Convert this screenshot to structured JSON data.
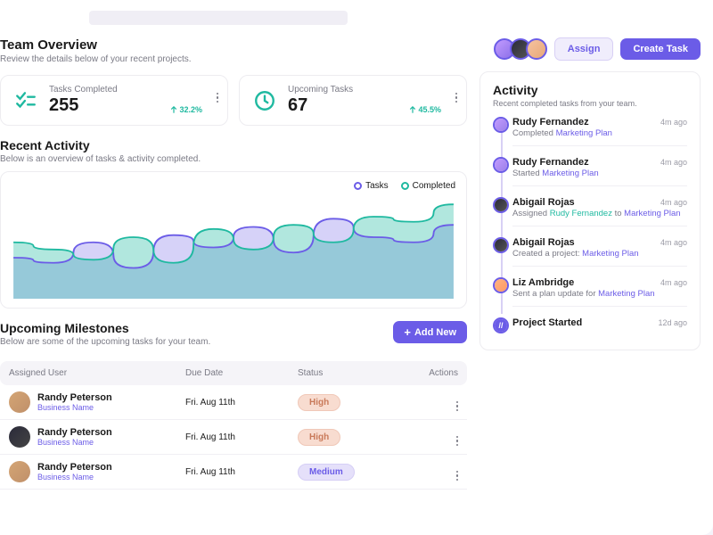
{
  "header": {
    "title": "Team Overview",
    "subtitle": "Review the details below of your recent projects.",
    "assign_label": "Assign",
    "create_task_label": "Create Task"
  },
  "stats": {
    "completed": {
      "label": "Tasks Completed",
      "value": "255",
      "delta": "32.2%"
    },
    "upcoming": {
      "label": "Upcoming Tasks",
      "value": "67",
      "delta": "45.5%"
    }
  },
  "recent_activity": {
    "title": "Recent Activity",
    "subtitle": "Below is an overview of tasks & activity completed.",
    "legend": {
      "tasks": "Tasks",
      "completed": "Completed"
    }
  },
  "chart_data": {
    "type": "area",
    "xlabel": "",
    "ylabel": "",
    "series": [
      {
        "name": "Tasks",
        "color": "#6b5ce7",
        "values": [
          40,
          35,
          55,
          30,
          62,
          50,
          70,
          45,
          78,
          60,
          55,
          72
        ]
      },
      {
        "name": "Completed",
        "color": "#1fb9a0",
        "values": [
          55,
          48,
          38,
          60,
          35,
          68,
          48,
          72,
          55,
          80,
          75,
          92
        ]
      }
    ]
  },
  "milestones": {
    "title": "Upcoming Milestones",
    "subtitle": "Below are some of the upcoming tasks for your team.",
    "add_label": "Add New",
    "columns": {
      "user": "Assigned User",
      "due": "Due Date",
      "status": "Status",
      "actions": "Actions"
    },
    "rows": [
      {
        "name": "Randy Peterson",
        "sub": "Business Name",
        "due": "Fri. Aug 11th",
        "status": "High"
      },
      {
        "name": "Randy Peterson",
        "sub": "Business Name",
        "due": "Fri. Aug 11th",
        "status": "High"
      },
      {
        "name": "Randy Peterson",
        "sub": "Business Name",
        "due": "Fri. Aug 11th",
        "status": "Medium"
      }
    ]
  },
  "activity": {
    "title": "Activity",
    "subtitle": "Recent completed tasks from your team.",
    "items": [
      {
        "name": "Rudy Fernandez",
        "time": "4m ago",
        "desc_pre": "Completed ",
        "link": "Marketing Plan"
      },
      {
        "name": "Rudy Fernandez",
        "time": "4m ago",
        "desc_pre": "Started ",
        "link": "Marketing Plan"
      },
      {
        "name": "Abigail Rojas",
        "time": "4m ago",
        "desc_pre": "Assigned ",
        "person": "Rudy Fernandez",
        "desc_mid": " to ",
        "link": "Marketing Plan"
      },
      {
        "name": "Abigail Rojas",
        "time": "4m ago",
        "desc_pre": "Created a project: ",
        "link": "Marketing Plan"
      },
      {
        "name": "Liz Ambridge",
        "time": "4m ago",
        "desc_pre": "Sent a plan update for ",
        "link": "Marketing Plan"
      },
      {
        "name": "Project Started",
        "time": "12d ago",
        "desc_pre": "",
        "link": ""
      }
    ]
  }
}
